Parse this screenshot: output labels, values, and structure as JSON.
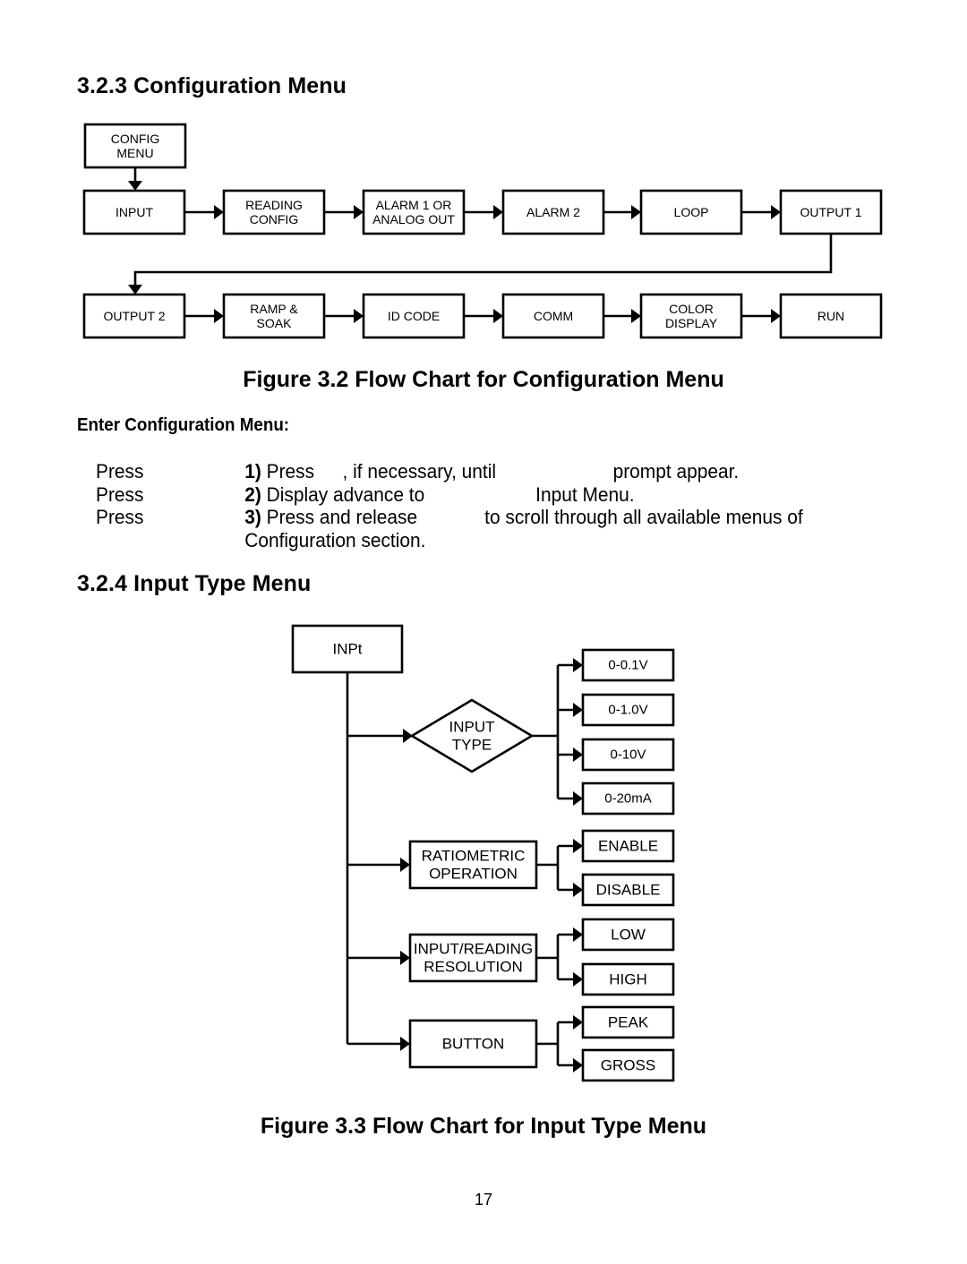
{
  "section_config": {
    "heading": "3.2.3 Configuration Menu",
    "flowchart": {
      "start": [
        "CONFIG",
        "MENU"
      ],
      "row1": [
        [
          "INPUT"
        ],
        [
          "READING",
          "CONFIG"
        ],
        [
          "ALARM 1 OR",
          "ANALOG OUT"
        ],
        [
          "ALARM 2"
        ],
        [
          "LOOP"
        ],
        [
          "OUTPUT 1"
        ]
      ],
      "row2": [
        [
          "OUTPUT 2"
        ],
        [
          "RAMP &",
          "SOAK"
        ],
        [
          "ID CODE"
        ],
        [
          "COMM"
        ],
        [
          "COLOR",
          "DISPLAY"
        ],
        [
          "RUN"
        ]
      ]
    },
    "caption": "Figure 3.2 Flow Chart for Configuration Menu"
  },
  "enter_config": {
    "subheading": "Enter Configuration Menu:",
    "steps": [
      {
        "left": "Press",
        "num": "1)",
        "text_a": "Press",
        "text_b": ", if necessary, until",
        "text_c": "prompt appear."
      },
      {
        "left": "Press",
        "num": "2)",
        "text_a": "Display advance to",
        "text_b": "Input Menu."
      },
      {
        "left": "Press",
        "num": "3)",
        "text_a": "Press and release",
        "text_b": "to scroll through all available menus of",
        "text_c": "Configuration section."
      }
    ]
  },
  "section_input": {
    "heading": "3.2.4  Input Type Menu",
    "flowchart": {
      "root": "INPt",
      "branches": [
        {
          "label": [
            "INPUT",
            "TYPE"
          ],
          "shape": "diamond",
          "options": [
            "0-0.1V",
            "0-1.0V",
            "0-10V",
            "0-20mA"
          ]
        },
        {
          "label": [
            "RATIOMETRIC",
            "OPERATION"
          ],
          "shape": "box",
          "options": [
            "ENABLE",
            "DISABLE"
          ]
        },
        {
          "label": [
            "INPUT/READING",
            "RESOLUTION"
          ],
          "shape": "box",
          "options": [
            "LOW",
            "HIGH"
          ]
        },
        {
          "label": [
            "BUTTON"
          ],
          "shape": "box",
          "options": [
            "PEAK",
            "GROSS"
          ]
        }
      ]
    },
    "caption": "Figure 3.3 Flow Chart for Input Type Menu"
  },
  "page_number": "17"
}
